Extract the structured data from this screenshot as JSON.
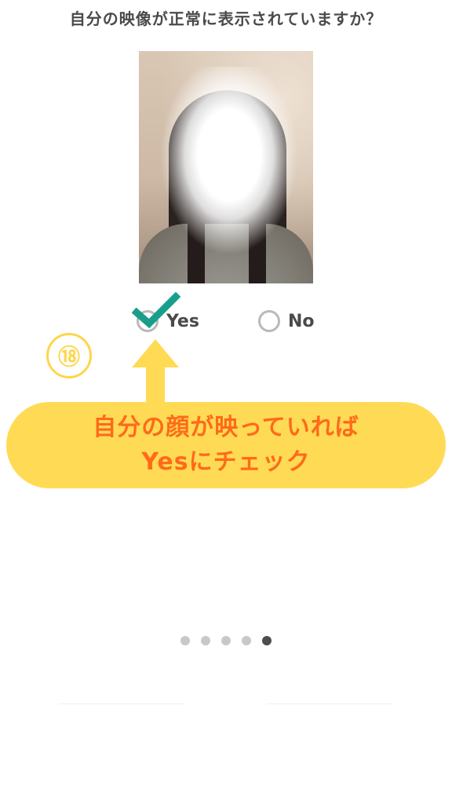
{
  "question": "自分の映像が正常に表示されていますか？",
  "options": {
    "yes_label": "Yes",
    "no_label": "No",
    "selected": "Yes"
  },
  "annotation": {
    "step_number": "⑱",
    "callout_line1": "自分の顔が映っていれば",
    "callout_line2": "Yesにチェック"
  },
  "pagination": {
    "total": 5,
    "active_index": 4
  },
  "colors": {
    "accent_yellow": "#ffdb55",
    "callout_text": "#ff6a1a",
    "check_teal": "#1a9e8c",
    "radio_border": "#b9b9b9"
  }
}
